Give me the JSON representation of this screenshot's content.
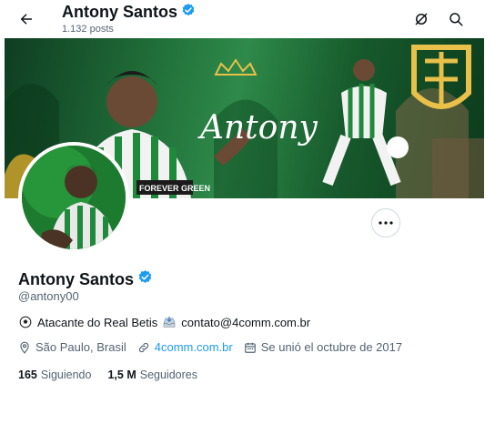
{
  "header": {
    "title": "Antony Santos",
    "posts_count": "1.132 posts"
  },
  "profile": {
    "name": "Antony Santos",
    "handle": "@antony00",
    "bio": {
      "text": "Atacante do Real Betis",
      "contact": "contato@4comm.com.br"
    },
    "location": "São Paulo, Brasil",
    "website": "4comm.com.br",
    "joined": "Se unió el octubre de 2017",
    "following_count": "165",
    "following_label": "Siguiendo",
    "followers_count": "1,5 M",
    "followers_label": "Seguidores",
    "banner_script": "Antony",
    "banner_jersey": "FOREVER GREEN"
  },
  "colors": {
    "verified": "#1d9bf0",
    "link": "#1d9bf0",
    "secondary_text": "#536471"
  }
}
